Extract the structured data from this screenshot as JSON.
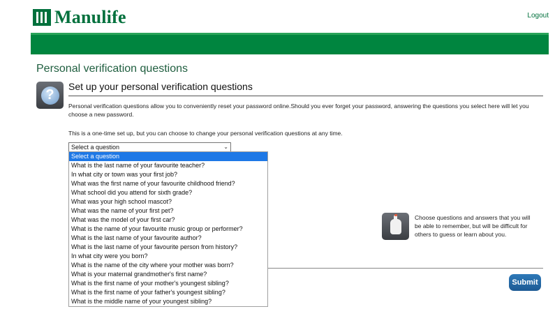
{
  "header": {
    "brand": "Manulife",
    "logout_label": "Logout",
    "brand_color": "#00703c"
  },
  "page": {
    "title": "Personal verification questions"
  },
  "setup": {
    "heading": "Set up your personal verification questions",
    "intro": "Personal verification questions allow you to conveniently reset your password online.Should you ever forget your password, answering the questions you select here will let you choose a new password.",
    "one_time_note": "This is a one-time set up, but you can choose to change your personal verification questions at any time."
  },
  "question_select": {
    "selected": "Select a question",
    "options": [
      "Select a question",
      "What is the last name of your favourite teacher?",
      "In what city or town was your first job?",
      "What was the first name of your favourite childhood friend?",
      "What school did you attend for sixth grade?",
      "What was your high school mascot?",
      "What was the name of your first pet?",
      "What was the model of your first car?",
      "What is the name of your favourite music group or performer?",
      "What is the last name of your favourite author?",
      "What is the last name of your favourite person from history?",
      "In what city were you born?",
      "What is the name of the city where your mother was born?",
      "What is your maternal grandmother's first name?",
      "What is the first name of your mother's youngest sibling?",
      "What is the first name of your father's youngest sibling?",
      "What is the middle name of your youngest sibling?"
    ]
  },
  "tip": {
    "text": "Choose questions and answers that you will be able to remember, but will be difficult for others to guess or learn about you.",
    "icon": "hand-pointer-icon"
  },
  "actions": {
    "submit_label": "Submit"
  }
}
